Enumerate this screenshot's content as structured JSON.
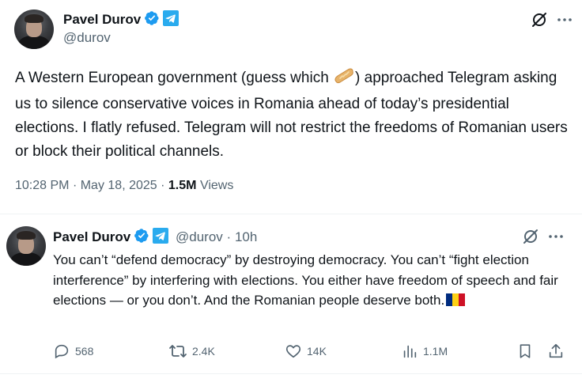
{
  "main_tweet": {
    "author_name": "Pavel Durov",
    "handle": "@durov",
    "text_before_emoji": "A Western European government (guess which ",
    "text_after_emoji": ") approached Telegram asking us to silence conservative voices in Romania ahead of today’s presidential elections. I flatly refused. Telegram will not restrict the freedoms of Romanian users or block their political channels.",
    "time": "10:28 PM",
    "date": "May 18, 2025",
    "views_count": "1.5M",
    "views_label": "Views",
    "separator": "·"
  },
  "reply_tweet": {
    "author_name": "Pavel Durov",
    "handle": "@durov",
    "separator": "·",
    "age": "10h",
    "text": "You can’t “defend democracy” by destroying democracy. You can’t “fight election interference” by interfering with elections. You either have freedom of speech and fair elections — or you don’t. And the Romanian people deserve both.",
    "actions": {
      "replies": "568",
      "reposts": "2.4K",
      "likes": "14K",
      "views": "1.1M"
    }
  },
  "icons": {
    "verified": "verified-badge-icon",
    "telegram": "telegram-icon",
    "grok": "grok-icon",
    "more": "more-icon",
    "reply": "reply-icon",
    "repost": "repost-icon",
    "like": "like-icon",
    "views": "views-icon",
    "bookmark": "bookmark-icon",
    "share": "share-icon",
    "bread_emoji": "baguette-emoji",
    "romania_flag": "romania-flag-emoji"
  },
  "colors": {
    "text": "#0f1419",
    "secondary": "#536471",
    "verified_blue": "#1d9bf0",
    "telegram_blue": "#2aabee",
    "divider": "#eff3f4"
  }
}
